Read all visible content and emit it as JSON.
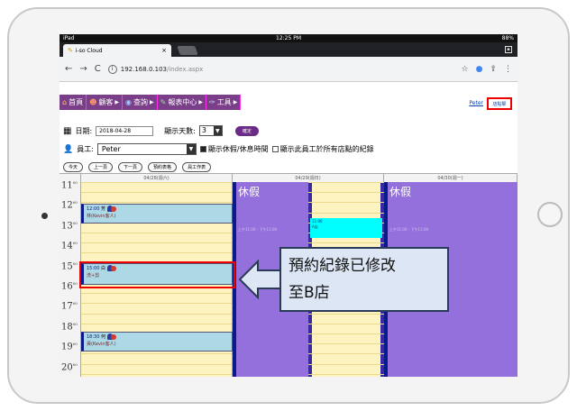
{
  "status": {
    "left": "iPad",
    "time": "12:25 PM",
    "battery": "88%"
  },
  "browser": {
    "tab_title": "i-so Cloud",
    "tab_close": "×",
    "url_host": "192.168.0.103",
    "url_path": "/index.aspx",
    "nav": [
      "←",
      "→",
      "C"
    ],
    "right_icons": [
      "☆",
      "🎤",
      "⇪",
      "⋮"
    ]
  },
  "menu": [
    {
      "label": "首頁",
      "icon": "home-icon"
    },
    {
      "label": "顧客",
      "icon": "customer-icon"
    },
    {
      "label": "查詢",
      "icon": "query-icon"
    },
    {
      "label": "報表中心",
      "icon": "report-icon"
    },
    {
      "label": "工具",
      "icon": "tool-icon"
    }
  ],
  "header_right": {
    "user": "Peter",
    "store_button": "店點擊"
  },
  "form": {
    "date_label": "日期:",
    "date_value": "2018-04-28",
    "days_label": "顯示天數:",
    "days_value": "3",
    "confirm": "確定",
    "employee_label": "員工:",
    "employee_value": "Peter",
    "chk1": "顯示休假/休息時間",
    "chk2": "顯示此員工於所有店點的紀錄"
  },
  "buttons": [
    "今天",
    "上一頁",
    "下一頁",
    "預約表格",
    "員工作表"
  ],
  "calendar": {
    "columns": [
      "04/28(週六)",
      "04/29(週日)",
      "04/30(週一)"
    ],
    "hours": [
      "11",
      "12",
      "13",
      "14",
      "15",
      "16",
      "17",
      "18",
      "19",
      "20"
    ],
    "hour_suffix": "00",
    "leave_label": "休假",
    "faint_b": "上午11:00 - 下午11:00",
    "faint_c": "上午11:00 - 下午11:00",
    "appt_c_time": "11:00",
    "appt_c_text": "A店",
    "appts": [
      {
        "time": "12:00",
        "name": "芳",
        "note": "林(Kevin客人)"
      },
      {
        "time": "15:00",
        "name": "白",
        "note": "洗+剪"
      },
      {
        "time": "18:30",
        "name": "何",
        "note": "黃(Kevin客人)"
      }
    ]
  },
  "callout": {
    "line1": "預約紀錄已修改",
    "line2": "至B店"
  }
}
